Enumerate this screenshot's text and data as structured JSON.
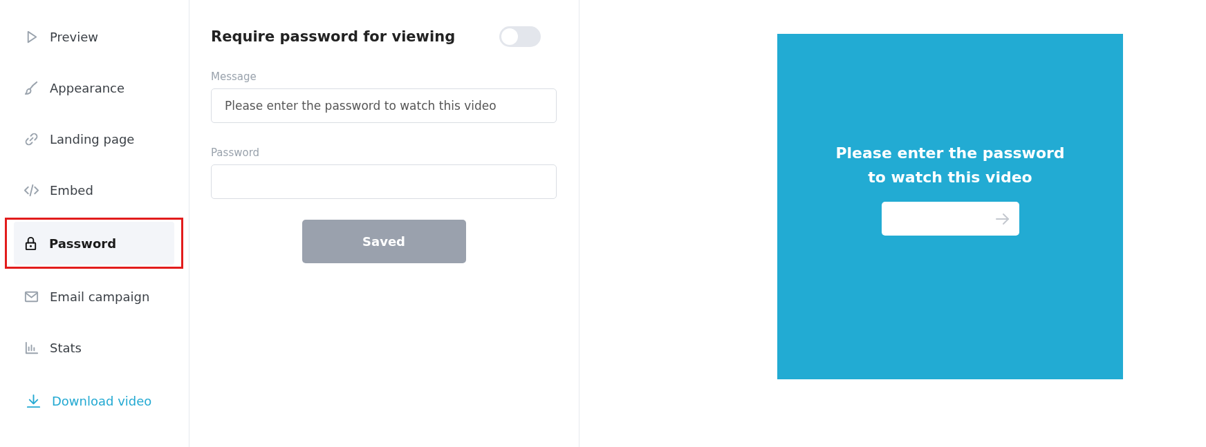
{
  "sidebar": {
    "items": [
      {
        "label": "Preview",
        "selected": false
      },
      {
        "label": "Appearance",
        "selected": false
      },
      {
        "label": "Landing page",
        "selected": false
      },
      {
        "label": "Embed",
        "selected": false
      },
      {
        "label": "Password",
        "selected": true
      },
      {
        "label": "Email campaign",
        "selected": false
      },
      {
        "label": "Stats",
        "selected": false
      }
    ],
    "download_link": {
      "label": "Download video"
    }
  },
  "settings": {
    "title": "Require password for viewing",
    "toggle": {
      "on": false
    },
    "message": {
      "label": "Message",
      "value": "Please enter the password to watch this video"
    },
    "password": {
      "label": "Password"
    },
    "save_button": {
      "label": "Saved",
      "disabled": true
    }
  },
  "preview": {
    "message": "Please enter the password to watch this video"
  }
}
